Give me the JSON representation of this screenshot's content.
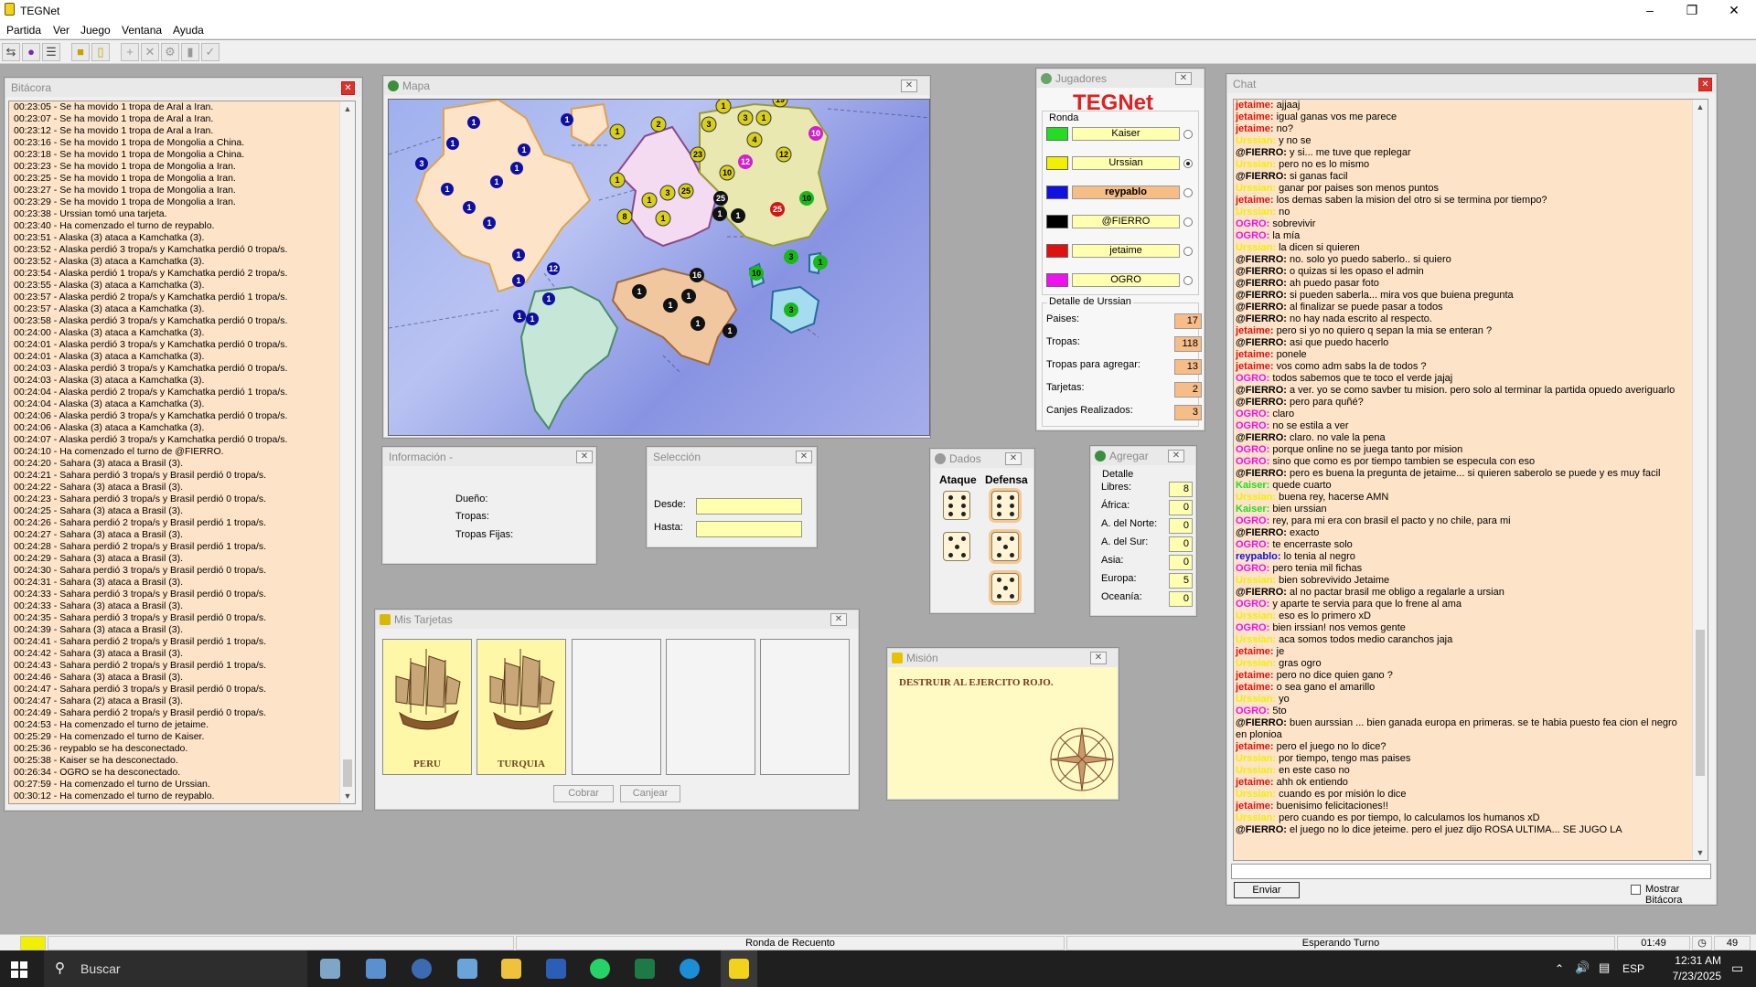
{
  "app": {
    "title": "TEGNet"
  },
  "menu": [
    "Partida",
    "Ver",
    "Juego",
    "Ventana",
    "Ayuda"
  ],
  "windows": {
    "bitacora": "Bitácora",
    "mapa": "Mapa",
    "jugadores": "Jugadores",
    "chat": "Chat",
    "informacion": "Información -",
    "seleccion": "Selección",
    "dados": "Dados",
    "agregar": "Agregar",
    "tarjetas": "Mis Tarjetas",
    "mision": "Misión"
  },
  "log": [
    "00:23:05 - Se ha movido 1 tropa de Aral a Iran.",
    "00:23:07 - Se ha movido 1 tropa de Aral a Iran.",
    "00:23:12 - Se ha movido 1 tropa de Aral a Iran.",
    "00:23:16 - Se ha movido 1 tropa de Mongolia a China.",
    "00:23:18 - Se ha movido 1 tropa de Mongolia a China.",
    "00:23:23 - Se ha movido 1 tropa de Mongolia a Iran.",
    "00:23:25 - Se ha movido 1 tropa de Mongolia a Iran.",
    "00:23:27 - Se ha movido 1 tropa de Mongolia a Iran.",
    "00:23:29 - Se ha movido 1 tropa de Mongolia a Iran.",
    "00:23:38 - Urssian tomó una tarjeta.",
    "00:23:40 - Ha comenzado el turno de reypablo.",
    "00:23:51 - Alaska (3) ataca a Kamchatka (3).",
    "00:23:52 - Alaska perdió 3 tropa/s y Kamchatka perdió 0 tropa/s.",
    "00:23:52 - Alaska (3) ataca a Kamchatka (3).",
    "00:23:54 - Alaska perdió 1 tropa/s y Kamchatka perdió 2 tropa/s.",
    "00:23:55 - Alaska (3) ataca a Kamchatka (3).",
    "00:23:57 - Alaska perdió 2 tropa/s y Kamchatka perdió 1 tropa/s.",
    "00:23:57 - Alaska (3) ataca a Kamchatka (3).",
    "00:23:58 - Alaska perdió 3 tropa/s y Kamchatka perdió 0 tropa/s.",
    "00:24:00 - Alaska (3) ataca a Kamchatka (3).",
    "00:24:01 - Alaska perdió 3 tropa/s y Kamchatka perdió 0 tropa/s.",
    "00:24:01 - Alaska (3) ataca a Kamchatka (3).",
    "00:24:03 - Alaska perdió 3 tropa/s y Kamchatka perdió 0 tropa/s.",
    "00:24:03 - Alaska (3) ataca a Kamchatka (3).",
    "00:24:04 - Alaska perdió 2 tropa/s y Kamchatka perdió 1 tropa/s.",
    "00:24:04 - Alaska (3) ataca a Kamchatka (3).",
    "00:24:06 - Alaska perdió 3 tropa/s y Kamchatka perdió 0 tropa/s.",
    "00:24:06 - Alaska (3) ataca a Kamchatka (3).",
    "00:24:07 - Alaska perdió 3 tropa/s y Kamchatka perdió 0 tropa/s.",
    "00:24:10 - Ha comenzado el turno de @FIERRO.",
    "00:24:20 - Sahara (3) ataca a Brasil (3).",
    "00:24:21 - Sahara perdió 3 tropa/s y Brasil perdió 0 tropa/s.",
    "00:24:22 - Sahara (3) ataca a Brasil (3).",
    "00:24:23 - Sahara perdió 3 tropa/s y Brasil perdió 0 tropa/s.",
    "00:24:25 - Sahara (3) ataca a Brasil (3).",
    "00:24:26 - Sahara perdió 2 tropa/s y Brasil perdió 1 tropa/s.",
    "00:24:27 - Sahara (3) ataca a Brasil (3).",
    "00:24:28 - Sahara perdió 2 tropa/s y Brasil perdió 1 tropa/s.",
    "00:24:29 - Sahara (3) ataca a Brasil (3).",
    "00:24:30 - Sahara perdió 3 tropa/s y Brasil perdió 0 tropa/s.",
    "00:24:31 - Sahara (3) ataca a Brasil (3).",
    "00:24:33 - Sahara perdió 3 tropa/s y Brasil perdió 0 tropa/s.",
    "00:24:33 - Sahara (3) ataca a Brasil (3).",
    "00:24:35 - Sahara perdió 3 tropa/s y Brasil perdió 0 tropa/s.",
    "00:24:39 - Sahara (3) ataca a Brasil (3).",
    "00:24:41 - Sahara perdió 2 tropa/s y Brasil perdió 1 tropa/s.",
    "00:24:42 - Sahara (3) ataca a Brasil (3).",
    "00:24:43 - Sahara perdió 2 tropa/s y Brasil perdió 1 tropa/s.",
    "00:24:46 - Sahara (3) ataca a Brasil (3).",
    "00:24:47 - Sahara perdió 3 tropa/s y Brasil perdió 0 tropa/s.",
    "00:24:47 - Sahara (2) ataca a Brasil (3).",
    "00:24:49 - Sahara perdió 2 tropa/s y Brasil perdió 0 tropa/s.",
    "00:24:53 - Ha comenzado el turno de jetaime.",
    "00:25:29 - Ha comenzado el turno de Kaiser.",
    "00:25:36 - reypablo se ha desconectado.",
    "00:25:38 - Kaiser se ha desconectado.",
    "00:26:34 - OGRO se ha desconectado.",
    "00:27:59 - Ha comenzado el turno de Urssian.",
    "00:30:12 - Ha comenzado el turno de reypablo."
  ],
  "jugadores": {
    "logo": "TEGNet",
    "ronda_label": "Ronda",
    "players": [
      {
        "name": "Kaiser",
        "color": "#22dd22",
        "active": false,
        "selected": false
      },
      {
        "name": "Urssian",
        "color": "#f0f000",
        "active": false,
        "selected": true
      },
      {
        "name": "reypablo",
        "color": "#1010e0",
        "active": true,
        "selected": false
      },
      {
        "name": "@FIERRO",
        "color": "#000000",
        "active": false,
        "selected": false
      },
      {
        "name": "jetaime",
        "color": "#e01010",
        "active": false,
        "selected": false
      },
      {
        "name": "OGRO",
        "color": "#ee10ee",
        "active": false,
        "selected": false
      }
    ],
    "detalle_title": "Detalle de Urssian",
    "stats": [
      {
        "label": "Paises:",
        "value": "17"
      },
      {
        "label": "Tropas:",
        "value": "118"
      },
      {
        "label": "Tropas para agregar:",
        "value": "13"
      },
      {
        "label": "Tarjetas:",
        "value": "2"
      },
      {
        "label": "Canjes Realizados:",
        "value": "3"
      }
    ]
  },
  "informacion": {
    "dueno": "Dueño:",
    "tropas": "Tropas:",
    "fijas": "Tropas Fijas:"
  },
  "seleccion": {
    "desde": "Desde:",
    "hasta": "Hasta:"
  },
  "dados": {
    "ataque": "Ataque",
    "defensa": "Defensa"
  },
  "agregar": {
    "detalle": "Detalle",
    "rows": [
      {
        "label": "Libres:",
        "value": "8"
      },
      {
        "label": "África:",
        "value": "0"
      },
      {
        "label": "A. del Norte:",
        "value": "0"
      },
      {
        "label": "A. del Sur:",
        "value": "0"
      },
      {
        "label": "Asia:",
        "value": "0"
      },
      {
        "label": "Europa:",
        "value": "5"
      },
      {
        "label": "Oceanía:",
        "value": "0"
      }
    ]
  },
  "tarjetas": {
    "cards": [
      "PERU",
      "TURQUIA"
    ],
    "cobrar": "Cobrar",
    "canjear": "Canjear"
  },
  "mision": {
    "text": "DESTRUIR AL EJERCITO ROJO."
  },
  "chat": {
    "send": "Enviar",
    "mostrar": "Mostrar Bitácora",
    "lines": [
      {
        "nick": "jetaime:",
        "text": " ajjaaj",
        "color": "#e01010"
      },
      {
        "nick": "jetaime:",
        "text": " igual ganas vos me parece",
        "color": "#e01010"
      },
      {
        "nick": "jetaime:",
        "text": " no?",
        "color": "#e01010"
      },
      {
        "nick": "Urssian:",
        "text": " y no se",
        "color": "#f0f000"
      },
      {
        "nick": "@FIERRO:",
        "text": " y si... me tuve que replegar",
        "color": "#000000"
      },
      {
        "nick": "Urssian:",
        "text": " pero no es lo mismo",
        "color": "#f0f000"
      },
      {
        "nick": "@FIERRO:",
        "text": " si ganas facil",
        "color": "#000000"
      },
      {
        "nick": "Urssian:",
        "text": " ganar por paises son menos puntos",
        "color": "#f0f000"
      },
      {
        "nick": "jetaime:",
        "text": " los demas saben la mision del otro si se termina por tiempo?",
        "color": "#e01010"
      },
      {
        "nick": "Urssian:",
        "text": " no",
        "color": "#f0f000"
      },
      {
        "nick": "OGRO:",
        "text": " sobrevivir",
        "color": "#ee10ee"
      },
      {
        "nick": "OGRO:",
        "text": " la mía",
        "color": "#ee10ee"
      },
      {
        "nick": "Urssian:",
        "text": " la dicen si quieren",
        "color": "#f0f000"
      },
      {
        "nick": "@FIERRO:",
        "text": " no. solo yo puedo saberlo.. si quiero",
        "color": "#000000"
      },
      {
        "nick": "@FIERRO:",
        "text": " o quizas si les opaso el admin",
        "color": "#000000"
      },
      {
        "nick": "@FIERRO:",
        "text": " ah puedo pasar foto",
        "color": "#000000"
      },
      {
        "nick": "@FIERRO:",
        "text": " si pueden saberla... mira vos que buiena pregunta",
        "color": "#000000"
      },
      {
        "nick": "@FIERRO:",
        "text": " al finalizar se puede pasar a todos",
        "color": "#000000"
      },
      {
        "nick": "@FIERRO:",
        "text": " no hay nada escrito al respecto.",
        "color": "#000000"
      },
      {
        "nick": "jetaime:",
        "text": " pero si yo no quiero  q sepan la mia se enteran ?",
        "color": "#e01010"
      },
      {
        "nick": "@FIERRO:",
        "text": " asi que puedo hacerlo",
        "color": "#000000"
      },
      {
        "nick": "jetaime:",
        "text": " ponele",
        "color": "#e01010"
      },
      {
        "nick": "jetaime:",
        "text": " vos como adm sabs la de todos ?",
        "color": "#e01010"
      },
      {
        "nick": "OGRO:",
        "text": " todos sabemos que te toco el verde jajaj",
        "color": "#ee10ee"
      },
      {
        "nick": "@FIERRO:",
        "text": " a ver. yo se como savber tu mision. pero solo al terminar la partida opuedo averiguarlo",
        "color": "#000000"
      },
      {
        "nick": "@FIERRO:",
        "text": " pero para quñé?",
        "color": "#000000"
      },
      {
        "nick": "OGRO:",
        "text": " claro",
        "color": "#ee10ee"
      },
      {
        "nick": "OGRO:",
        "text": " no se estila a ver",
        "color": "#ee10ee"
      },
      {
        "nick": "@FIERRO:",
        "text": " claro. no vale la pena",
        "color": "#000000"
      },
      {
        "nick": "OGRO:",
        "text": " porque online no se juega tanto por mision",
        "color": "#ee10ee"
      },
      {
        "nick": "OGRO:",
        "text": " sino que como es por tiempo tambien se especula con eso",
        "color": "#ee10ee"
      },
      {
        "nick": "@FIERRO:",
        "text": " pero es buena la pregunta de jetaime... si quieren saberolo se puede y es muy facil",
        "color": "#000000"
      },
      {
        "nick": "Kaiser:",
        "text": " quede cuarto",
        "color": "#22dd22"
      },
      {
        "nick": "Urssian:",
        "text": " buena rey, hacerse AMN",
        "color": "#f0f000"
      },
      {
        "nick": "Kaiser:",
        "text": " bien urssian",
        "color": "#22dd22"
      },
      {
        "nick": "OGRO:",
        "text": " rey, para mi era con brasil el pacto y no chile, para mi",
        "color": "#ee10ee"
      },
      {
        "nick": "@FIERRO:",
        "text": " exacto",
        "color": "#000000"
      },
      {
        "nick": "OGRO:",
        "text": " te encerraste solo",
        "color": "#ee10ee"
      },
      {
        "nick": "reypablo:",
        "text": "  lo tenia al negro",
        "color": "#1010e0"
      },
      {
        "nick": "OGRO:",
        "text": " pero tenia mil fichas",
        "color": "#ee10ee"
      },
      {
        "nick": "Urssian:",
        "text": " bien sobrevivido Jetaime",
        "color": "#f0f000"
      },
      {
        "nick": "@FIERRO:",
        "text": "  al no pactar brasil me obligo a regalarle a ursian",
        "color": "#000000"
      },
      {
        "nick": "OGRO:",
        "text": " y aparte te servia para que lo frene al ama",
        "color": "#ee10ee"
      },
      {
        "nick": "Urssian:",
        "text": " eso es lo primero xD",
        "color": "#f0f000"
      },
      {
        "nick": "OGRO:",
        "text": " bien irssian! nos vemos gente",
        "color": "#ee10ee"
      },
      {
        "nick": "Urssian:",
        "text": " aca somos todos medio caranchos jaja",
        "color": "#f0f000"
      },
      {
        "nick": "jetaime:",
        "text": " je",
        "color": "#e01010"
      },
      {
        "nick": "Urssian:",
        "text": " gras ogro",
        "color": "#f0f000"
      },
      {
        "nick": "jetaime:",
        "text": " pero no dice quien gano ?",
        "color": "#e01010"
      },
      {
        "nick": "jetaime:",
        "text": " o sea gano el amarillo",
        "color": "#e01010"
      },
      {
        "nick": "Urssian:",
        "text": " yo",
        "color": "#f0f000"
      },
      {
        "nick": "OGRO:",
        "text": " 5to",
        "color": "#ee10ee"
      },
      {
        "nick": "@FIERRO:",
        "text": " buen aurssian ... bien ganada europa en primeras. se te habia puesto fea cion el negro en plonioa",
        "color": "#000000"
      },
      {
        "nick": "jetaime:",
        "text": " pero el juego no lo dice?",
        "color": "#e01010"
      },
      {
        "nick": "Urssian:",
        "text": " por tiempo, tengo mas paises",
        "color": "#f0f000"
      },
      {
        "nick": "Urssian:",
        "text": " en este caso no",
        "color": "#f0f000"
      },
      {
        "nick": "jetaime:",
        "text": " ahh ok entiendo",
        "color": "#e01010"
      },
      {
        "nick": "Urssian:",
        "text": " cuando es por misión lo dice",
        "color": "#f0f000"
      },
      {
        "nick": "jetaime:",
        "text": " buenisimo felicitaciones!!",
        "color": "#e01010"
      },
      {
        "nick": "Urssian:",
        "text": " pero cuando es por tiempo, lo calculamos los humanos xD",
        "color": "#f0f000"
      },
      {
        "nick": "@FIERRO:",
        "text": " el juego no lo dice jeteime. pero el juez dijo ROSA ULTIMA... SE JUGO LA",
        "color": "#000000"
      }
    ]
  },
  "status": {
    "ronda": "Ronda de Recuento",
    "esperando": "Esperando Turno",
    "time": "01:49",
    "num": "49"
  },
  "taskbar": {
    "search": "Buscar",
    "lang": "ESP",
    "time": "12:31 AM",
    "date": "7/23/2025"
  }
}
